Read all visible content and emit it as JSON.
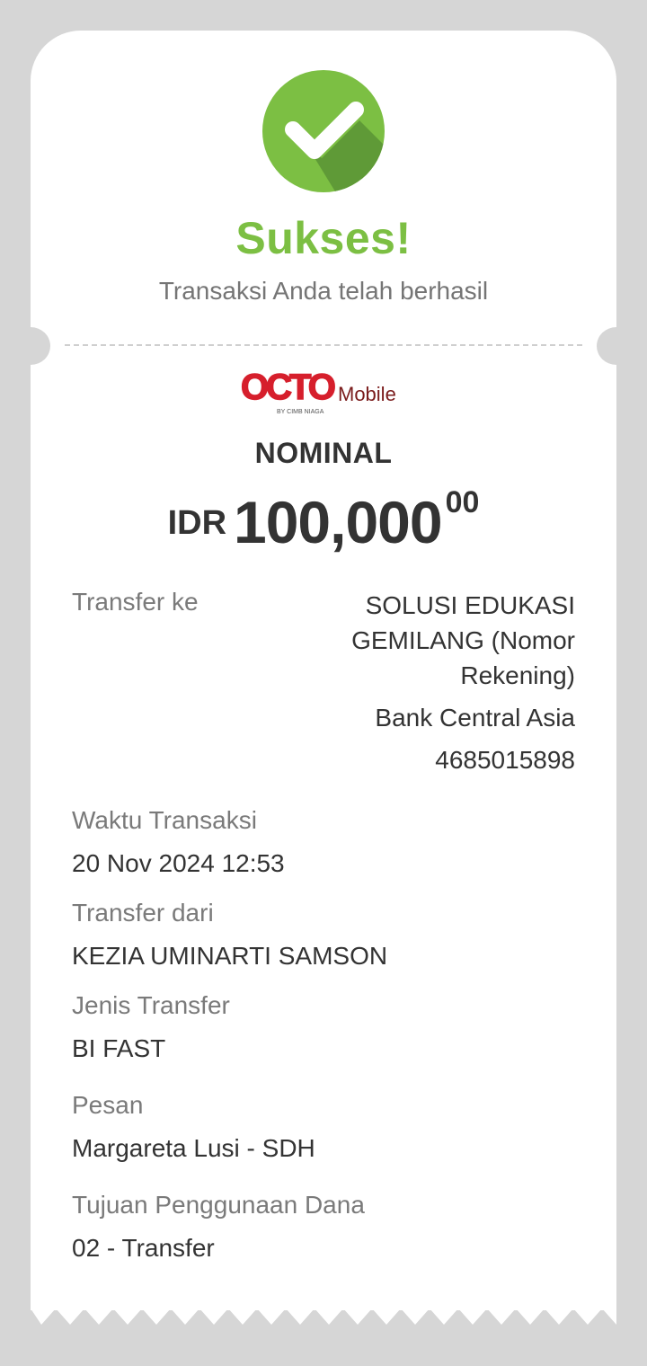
{
  "status": {
    "title": "Sukses!",
    "subtitle": "Transaksi Anda telah berhasil",
    "color": "#7cbf43"
  },
  "logo": {
    "brand": "OCTO",
    "product": "Mobile",
    "byline": "BY CIMB NIAGA"
  },
  "nominal": {
    "label": "NOMINAL",
    "currency": "IDR",
    "amount": "100,000",
    "decimals": "00"
  },
  "transfer_to": {
    "label": "Transfer ke",
    "name_line1": "SOLUSI EDUKASI",
    "name_line2": "GEMILANG (Nomor",
    "name_line3": "Rekening)",
    "bank": "Bank Central Asia",
    "account": "4685015898"
  },
  "details": {
    "time_label": "Waktu Transaksi",
    "time_value": "20 Nov 2024 12:53",
    "from_label": "Transfer dari",
    "from_value": "KEZIA UMINARTI SAMSON",
    "type_label": "Jenis Transfer",
    "type_value": "BI FAST",
    "message_label": "Pesan",
    "message_value": "Margareta Lusi - SDH",
    "purpose_label": "Tujuan Penggunaan Dana",
    "purpose_value": "02 - Transfer"
  },
  "colors": {
    "success_green": "#7cbf43",
    "brand_red": "#d61f2c",
    "brand_dark": "#7a1b1b"
  }
}
